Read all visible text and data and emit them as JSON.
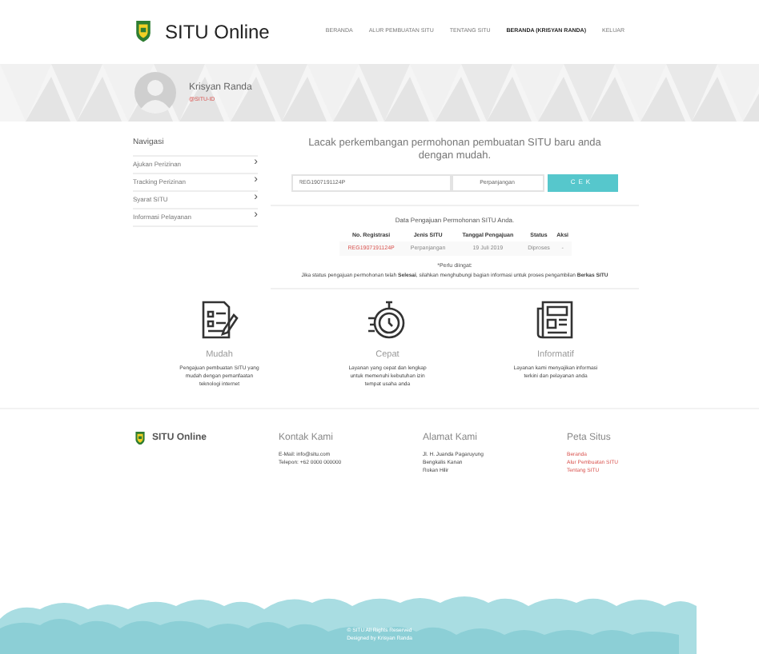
{
  "header": {
    "brand": "SITU Online",
    "nav": [
      {
        "label": "BERANDA",
        "selected": false
      },
      {
        "label": "ALUR PEMBUATAN SITU",
        "selected": false
      },
      {
        "label": "TENTANG SITU",
        "selected": false
      },
      {
        "label": "BERANDA (KRISYAN RANDA)",
        "selected": true
      },
      {
        "label": "KELUAR",
        "selected": false
      }
    ]
  },
  "profile": {
    "name": "Krisyan Randa",
    "subtitle": "@SITU-ID"
  },
  "sidebar": {
    "title": "Navigasi",
    "items": [
      {
        "label": "Ajukan Perizinan",
        "arrow": "›"
      },
      {
        "label": "Tracking Perizinan",
        "arrow": "›"
      },
      {
        "label": "Syarat SITU",
        "arrow": "›"
      },
      {
        "label": "Informasi Pelayanan",
        "arrow": "›"
      }
    ]
  },
  "tracking": {
    "heading": "Lacak perkembangan permohonan pembuatan SITU baru anda dengan mudah.",
    "input_value": "REG1907191124P",
    "select_value": "Perpanjangan",
    "button": "CEK"
  },
  "table": {
    "title": "Data Pengajuan Permohonan SITU Anda.",
    "columns": [
      "No. Registrasi",
      "Jenis SITU",
      "Tanggal Pengajuan",
      "Status",
      "Aksi"
    ],
    "rows": [
      [
        "REG1907191124P",
        "Perpanjangan",
        "19 Juli 2019",
        "Diproses",
        "-"
      ]
    ]
  },
  "note": {
    "title": "*Perlu diingat:",
    "text": "Jika status pengajuan permohonan telah **Selesai**, silahkan menghubungi bagian informasi untuk proses pengambilan **Berkas SITU**"
  },
  "features": [
    {
      "kind": "form",
      "title": "Mudah",
      "text": "Pengajuan pembuatan SITU yang mudah dengan pemanfaatan teknologi internet"
    },
    {
      "kind": "stopwatch",
      "title": "Cepat",
      "text": "Layanan yang cepat dan lengkap untuk memenuhi kebutuhan izin tempat usaha anda"
    },
    {
      "kind": "news",
      "title": "Informatif",
      "text": "Layanan kami menyajikan informasi terkini dan pelayanan anda"
    }
  ],
  "footer": {
    "brand": "SITU Online",
    "columns": [
      {
        "title": "Kontak Kami",
        "kind": "plain",
        "lines": [
          "E-Mail: info@situ.com",
          "Telepon: +62 0000 000000"
        ]
      },
      {
        "title": "Alamat Kami",
        "kind": "plain",
        "lines": [
          "Jl. H. Juanda Pagaruyung",
          "Bengkalis Kanan",
          "Rokan Hilir"
        ]
      },
      {
        "title": "Peta Situs",
        "kind": "links",
        "lines": [
          "Beranda",
          "Alur Pembuatan SITU",
          "Tentang SITU"
        ]
      }
    ],
    "copyright": "© SITU All Rights Reserved",
    "credit": "Designed by Krisyan Randa"
  }
}
